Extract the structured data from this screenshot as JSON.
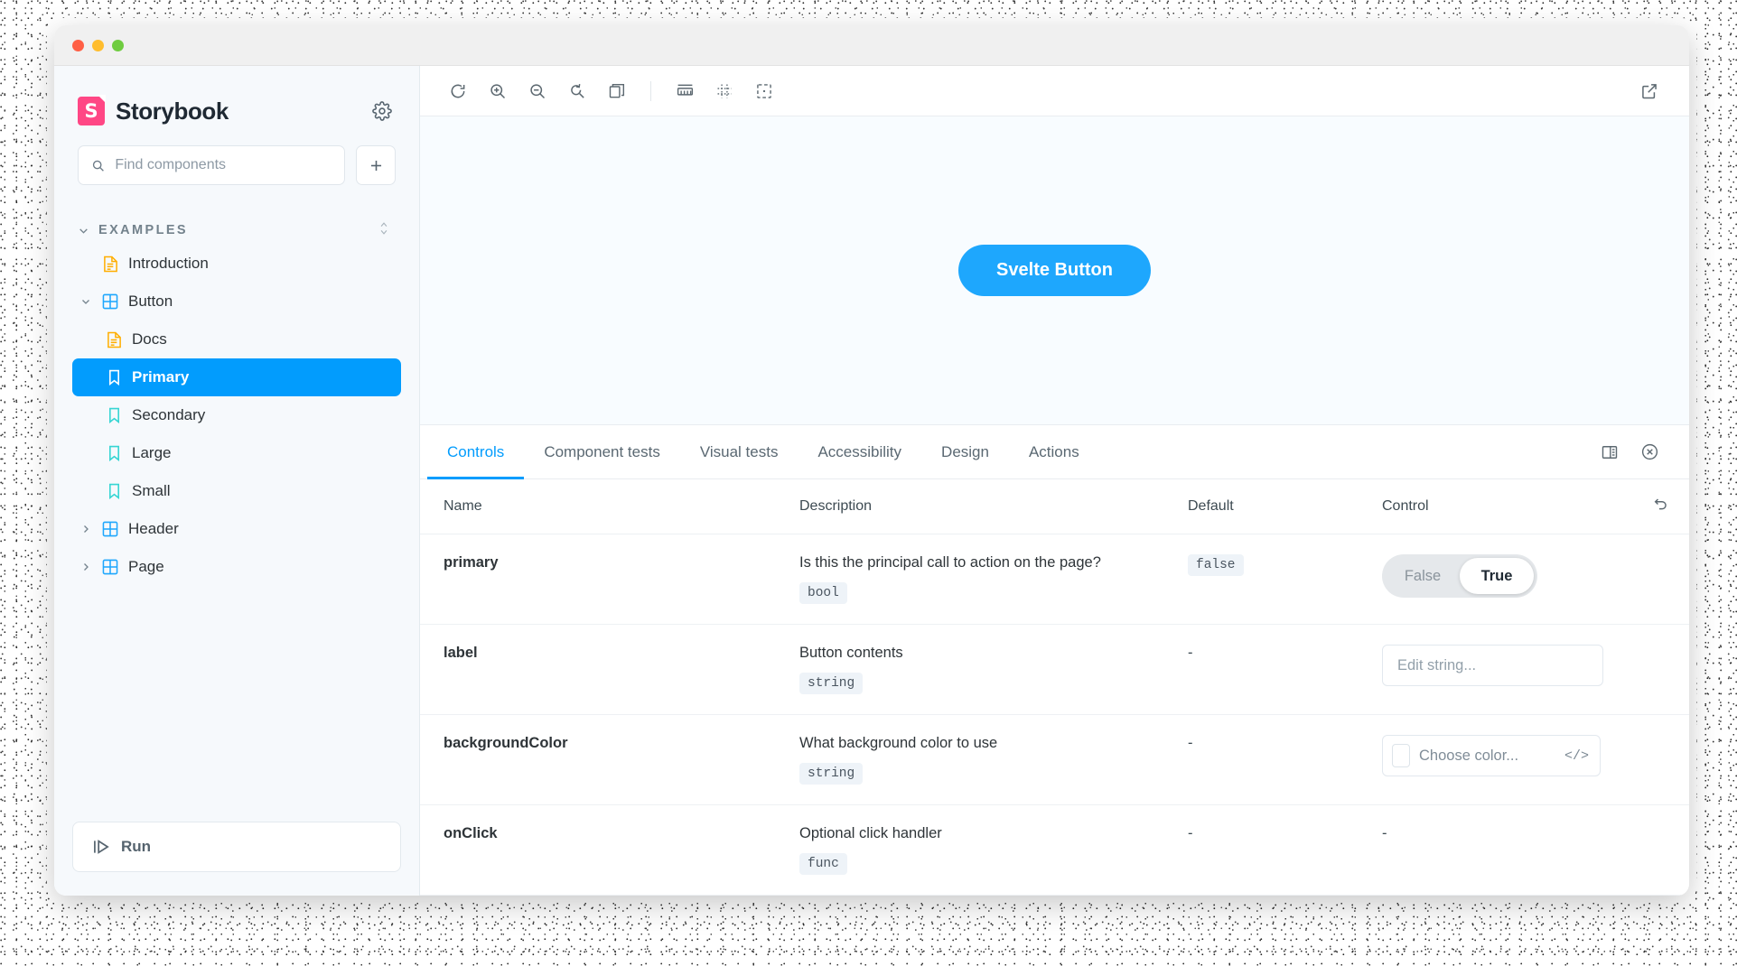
{
  "window": {
    "traffic_lights": [
      "close",
      "minimize",
      "maximize"
    ]
  },
  "sidebar": {
    "brand": {
      "logo_letter": "S",
      "name": "Storybook",
      "logo_color": "#ff4785"
    },
    "settings_icon": "gear-icon",
    "search": {
      "placeholder": "Find components",
      "value": "",
      "icon": "search-icon"
    },
    "add_button_icon": "plus-icon",
    "group": {
      "label": "EXAMPLES",
      "expanded": true,
      "caret_icon": "chevron-down-icon",
      "sort_icon": "expand-collapse-icon"
    },
    "tree": [
      {
        "label": "Introduction",
        "icon": "document-icon",
        "level": 1,
        "caret": "none",
        "selected": false
      },
      {
        "label": "Button",
        "icon": "component-icon",
        "level": 1,
        "caret": "chevron-down",
        "selected": false
      },
      {
        "label": "Docs",
        "icon": "document-icon",
        "level": 2,
        "caret": "none",
        "selected": false
      },
      {
        "label": "Primary",
        "icon": "story-icon",
        "level": 2,
        "caret": "none",
        "selected": true
      },
      {
        "label": "Secondary",
        "icon": "story-icon",
        "level": 2,
        "caret": "none",
        "selected": false
      },
      {
        "label": "Large",
        "icon": "story-icon",
        "level": 2,
        "caret": "none",
        "selected": false
      },
      {
        "label": "Small",
        "icon": "story-icon",
        "level": 2,
        "caret": "none",
        "selected": false
      },
      {
        "label": "Header",
        "icon": "component-icon",
        "level": 1,
        "caret": "chevron-right",
        "selected": false
      },
      {
        "label": "Page",
        "icon": "component-icon",
        "level": 1,
        "caret": "chevron-right",
        "selected": false
      }
    ],
    "run": {
      "label": "Run",
      "icon": "play-test-icon"
    },
    "selected_color": "#029cfd"
  },
  "toolbar": {
    "buttons": [
      {
        "name": "remount-icon",
        "title": "Remount component"
      },
      {
        "name": "zoom-in-icon",
        "title": "Zoom in"
      },
      {
        "name": "zoom-out-icon",
        "title": "Zoom out"
      },
      {
        "name": "zoom-reset-icon",
        "title": "Reset zoom"
      },
      {
        "name": "backgrounds-icon",
        "title": "Change background"
      },
      {
        "name": "measure-icon",
        "title": "Enable measure"
      },
      {
        "name": "grid-icon",
        "title": "Apply grid"
      },
      {
        "name": "outline-icon",
        "title": "Apply outlines"
      }
    ],
    "open_new_tab_icon": "external-link-icon"
  },
  "preview": {
    "button_label": "Svelte Button",
    "button_color": "#1ea7fd",
    "canvas_background": "#f8fcff"
  },
  "panel": {
    "tabs": [
      {
        "label": "Controls",
        "active": true
      },
      {
        "label": "Component tests",
        "active": false
      },
      {
        "label": "Visual tests",
        "active": false
      },
      {
        "label": "Accessibility",
        "active": false
      },
      {
        "label": "Design",
        "active": false
      },
      {
        "label": "Actions",
        "active": false
      }
    ],
    "layout_icon": "panel-position-icon",
    "close_icon": "close-circle-icon",
    "accent_color": "#029cfd"
  },
  "controls": {
    "columns": {
      "name": "Name",
      "description": "Description",
      "default": "Default",
      "control": "Control"
    },
    "reset_icon": "reset-icon",
    "rows": [
      {
        "name": "primary",
        "description": "Is this the principal call to action on the page?",
        "type": "bool",
        "default": "false",
        "default_is_chip": true,
        "control": {
          "kind": "boolean",
          "options": [
            "False",
            "True"
          ],
          "selected": "True"
        }
      },
      {
        "name": "label",
        "description": "Button contents",
        "type": "string",
        "default": "-",
        "default_is_chip": false,
        "control": {
          "kind": "text",
          "placeholder": "Edit string...",
          "value": ""
        }
      },
      {
        "name": "backgroundColor",
        "description": "What background color to use",
        "type": "string",
        "default": "-",
        "default_is_chip": false,
        "control": {
          "kind": "color",
          "placeholder": "Choose color...",
          "value": "",
          "code_toggle": "</>"
        }
      },
      {
        "name": "onClick",
        "description": "Optional click handler",
        "type": "func",
        "default": "-",
        "default_is_chip": false,
        "control": {
          "kind": "none",
          "placeholder": "-"
        }
      }
    ]
  }
}
